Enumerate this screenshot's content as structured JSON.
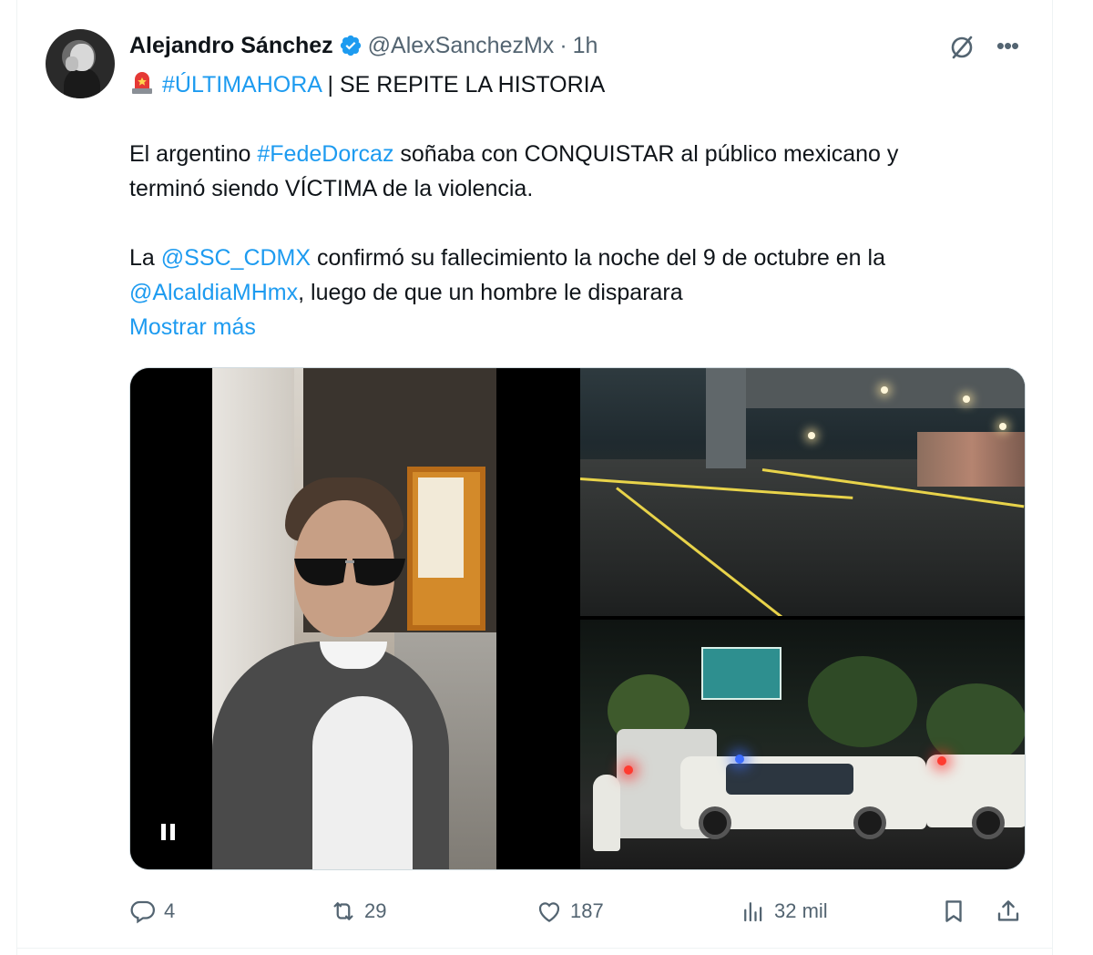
{
  "tweet": {
    "author_name": "Alejandro Sánchez",
    "handle": "@AlexSanchezMx",
    "separator": "·",
    "time": "1h",
    "headline_hashtag": "#ÚLTIMAHORA",
    "headline_rest": " | SE REPITE LA HISTORIA",
    "p1_a": "El argentino ",
    "p1_hashtag": "#FedeDorcaz",
    "p1_b": " soñaba con CONQUISTAR al público mexicano y",
    "p1_line2": "terminó siendo VÍCTIMA de la violencia.",
    "p2_a": "La ",
    "p2_mention": "@SSC_CDMX",
    "p2_b": " confirmó su fallecimiento la noche del 9 de octubre en la",
    "p2_mention2": "@AlcaldiaMHmx",
    "p2_c": ", luego de que un hombre le disparara",
    "show_more": "Mostrar más"
  },
  "actions": {
    "replies": "4",
    "reposts": "29",
    "likes": "187",
    "views": "32 mil"
  },
  "colors": {
    "link": "#1d9bf0",
    "verified": "#1d9bf0",
    "muted": "#536471"
  },
  "icons": {
    "verified": "verified-badge-icon",
    "grok": "grok-icon",
    "more": "more-icon",
    "siren": "siren-emoji-icon",
    "reply": "reply-icon",
    "repost": "repost-icon",
    "like": "like-icon",
    "views": "views-icon",
    "bookmark": "bookmark-icon",
    "share": "share-icon",
    "pause": "pause-icon"
  }
}
